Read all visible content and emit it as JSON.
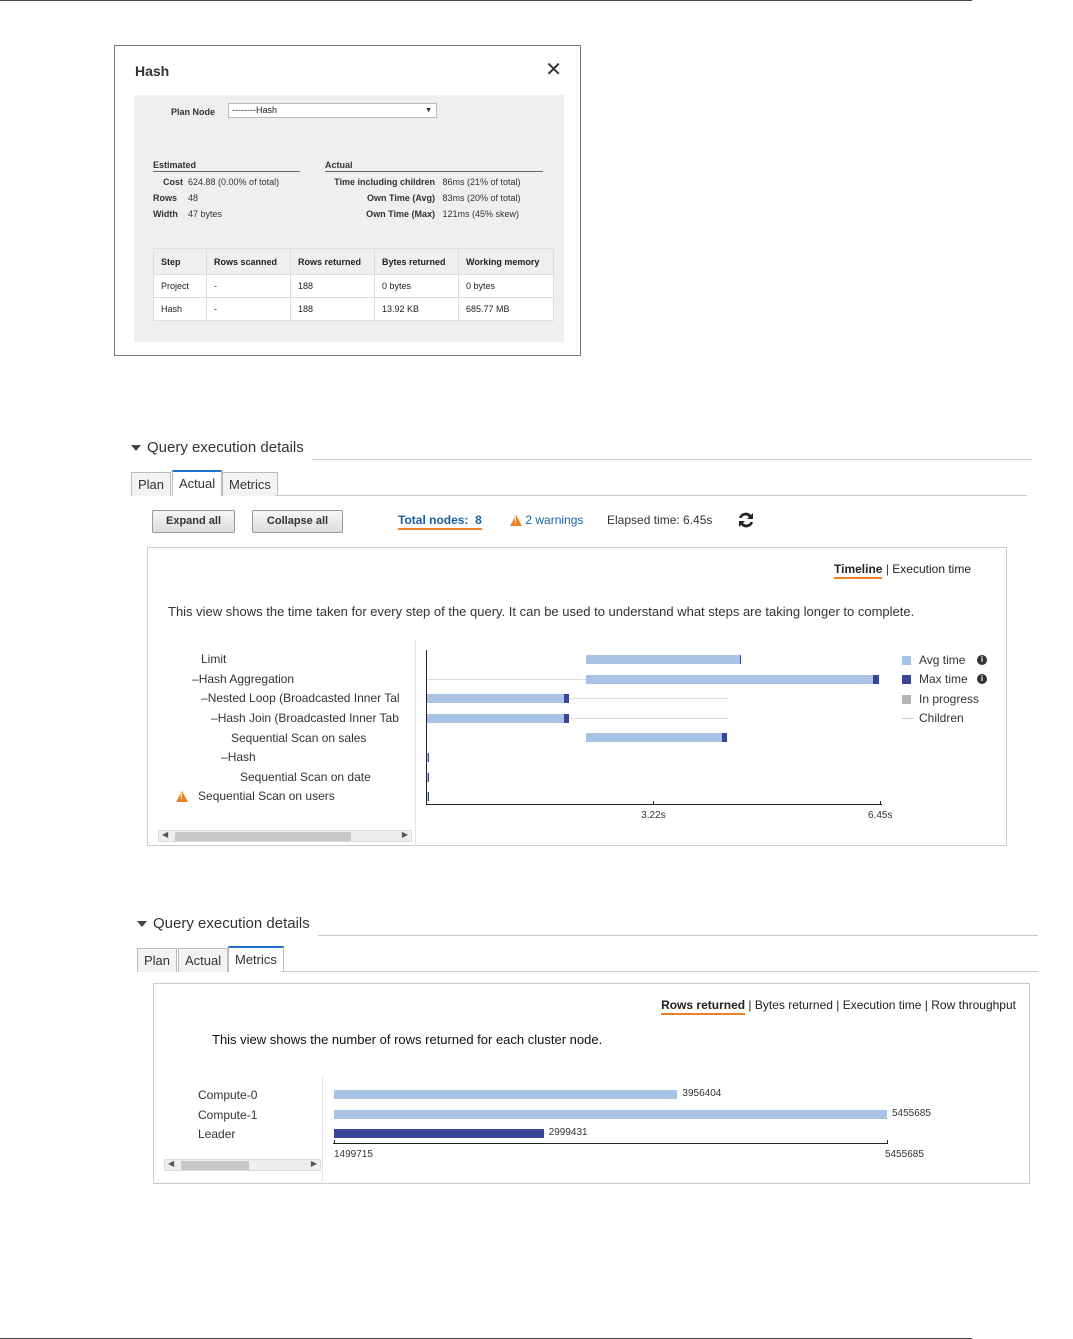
{
  "hash_dialog": {
    "title": "Hash",
    "close_glyph": "✕",
    "plan_node_label": "Plan Node",
    "plan_node_value": "--------Hash",
    "estimated": {
      "heading": "Estimated",
      "rows": [
        {
          "key": "Cost",
          "value": "624.88 (0.00% of total)"
        },
        {
          "key": "Rows",
          "value": "48"
        },
        {
          "key": "Width",
          "value": "47 bytes"
        }
      ]
    },
    "actual": {
      "heading": "Actual",
      "rows": [
        {
          "key": "Time including children",
          "value": "86ms (21% of total)"
        },
        {
          "key": "Own Time (Avg)",
          "value": "83ms (20% of total)"
        },
        {
          "key": "Own Time (Max)",
          "value": "121ms (45% skew)"
        }
      ]
    },
    "table": {
      "headers": [
        "Step",
        "Rows scanned",
        "Rows returned",
        "Bytes returned",
        "Working memory"
      ],
      "rows": [
        [
          "Project",
          "-",
          "188",
          "0 bytes",
          "0 bytes"
        ],
        [
          "Hash",
          "-",
          "188",
          "13.92 KB",
          "685.77 MB"
        ]
      ]
    }
  },
  "actual_section": {
    "heading": "Query execution details",
    "tabs": [
      "Plan",
      "Actual",
      "Metrics"
    ],
    "active_tab": "Actual",
    "expand_all": "Expand all",
    "collapse_all": "Collapse all",
    "total_nodes_label": "Total nodes:",
    "total_nodes_value": "8",
    "warnings": "2 warnings",
    "elapsed": "Elapsed time: 6.45s",
    "view_links": [
      "Timeline",
      "Execution time"
    ],
    "description": "This view shows the time taken for every step of the query. It can be used to understand what steps are taking longer to complete.",
    "nodes": [
      "Limit",
      "Hash Aggregation",
      "Nested Loop (Broadcasted Inner Tal",
      "Hash Join (Broadcasted Inner Tab",
      "Sequential Scan on sales",
      "Hash",
      "Sequential Scan on date",
      "Sequential Scan on users"
    ],
    "legend": [
      "Avg time",
      "Max time",
      "In progress",
      "Children"
    ],
    "colors": {
      "avg": "#a8c3e6",
      "max": "#3c4495",
      "in_progress": "#b5b5b5",
      "children": "#dddddd",
      "accent": "#e8822a",
      "link": "#1a5fa8"
    },
    "chart_data": {
      "type": "bar",
      "xlabel": "",
      "xlim": [
        0,
        6.45
      ],
      "ticks": [
        "3.22s",
        "6.45s"
      ],
      "categories": [
        "Limit",
        "Hash Aggregation",
        "Nested Loop (Broadcasted Inner Tal",
        "Hash Join (Broadcasted Inner Tab",
        "Sequential Scan on sales",
        "Hash",
        "Sequential Scan on date",
        "Sequential Scan on users"
      ],
      "series": [
        {
          "name": "Avg time",
          "start": [
            2.27,
            2.27,
            0,
            0,
            2.27,
            0,
            0,
            0
          ],
          "end": [
            4.45,
            6.35,
            1.95,
            1.95,
            4.2,
            0.02,
            0.02,
            0.02
          ]
        },
        {
          "name": "Max time",
          "end": [
            4.47,
            6.43,
            2.02,
            2.02,
            4.27,
            0.03,
            0.03,
            0.03
          ]
        },
        {
          "name": "Children",
          "start": [
            null,
            0,
            0,
            0,
            null,
            null,
            null,
            null
          ],
          "end": [
            null,
            2.27,
            4.3,
            4.3,
            null,
            null,
            null,
            null
          ]
        }
      ]
    }
  },
  "metrics_section": {
    "heading": "Query execution details",
    "tabs": [
      "Plan",
      "Actual",
      "Metrics"
    ],
    "active_tab": "Metrics",
    "view_links": [
      "Rows returned",
      "Bytes returned",
      "Execution time",
      "Row throughput"
    ],
    "description": "This view shows the number of rows returned for each cluster node.",
    "chart_data": {
      "type": "bar",
      "categories": [
        "Compute-0",
        "Compute-1",
        "Leader"
      ],
      "values": [
        3956404,
        5455685,
        2999431
      ],
      "value_labels": [
        "3956404",
        "5455685",
        "2999431"
      ],
      "xlim": [
        1499715,
        5455685
      ],
      "ticks": [
        "1499715",
        "5455685"
      ]
    }
  }
}
